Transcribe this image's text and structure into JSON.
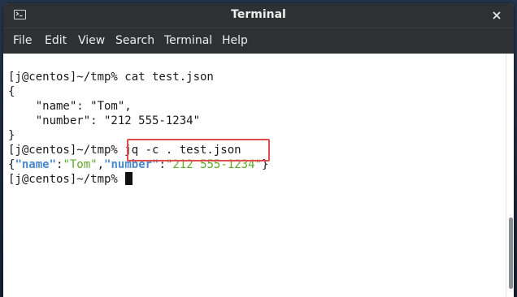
{
  "window": {
    "title": "Terminal",
    "icon": "terminal-icon",
    "close_icon": "close-icon"
  },
  "menubar": {
    "items": [
      "File",
      "Edit",
      "View",
      "Search",
      "Terminal",
      "Help"
    ]
  },
  "terminal": {
    "prompt": "[j@centos]~/tmp%",
    "lines": {
      "l1_cmd": " cat test.json",
      "l2": "{",
      "l3": "    \"name\": \"Tom\",",
      "l4": "    \"number\": \"212 555-1234\"",
      "l5": "}",
      "l6_cmd": " jq -c . test.json",
      "l7": {
        "open": "{",
        "key1": "\"name\"",
        "colon1": ":",
        "val1": "\"Tom\"",
        "comma": ",",
        "key2": "\"number\"",
        "colon2": ":",
        "val2": "\"212 555-1234\"",
        "close": "}"
      },
      "l8": " "
    }
  },
  "colors": {
    "titlebar_bg": "#2d3134",
    "terminal_bg": "#ffffff",
    "json_key": "#4a8ad0",
    "json_string": "#5ea82a",
    "highlight": "#e04b4b"
  }
}
